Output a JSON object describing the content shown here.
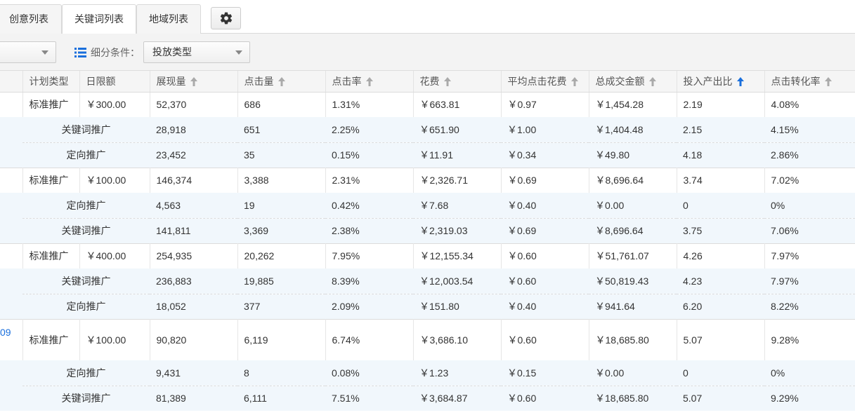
{
  "tabs": [
    {
      "label": "创意列表",
      "active": false
    },
    {
      "label": "关键词列表",
      "active": true
    },
    {
      "label": "地域列表",
      "active": false
    }
  ],
  "settings": {
    "icon": "gear-icon"
  },
  "filter": {
    "segment_label": "细分条件：",
    "segment_icon": "list-icon",
    "segment_value": "投放类型"
  },
  "table": {
    "columns": [
      {
        "label": "计划类型",
        "sortable": false
      },
      {
        "label": "日限额",
        "sortable": false
      },
      {
        "label": "展现量",
        "sortable": true
      },
      {
        "label": "点击量",
        "sortable": true
      },
      {
        "label": "点击率",
        "sortable": true
      },
      {
        "label": "花费",
        "sortable": true
      },
      {
        "label": "平均点击花费",
        "sortable": true
      },
      {
        "label": "总成交金额",
        "sortable": true
      },
      {
        "label": "投入产出比",
        "sortable": true,
        "active": true
      },
      {
        "label": "点击转化率",
        "sortable": true
      }
    ],
    "groups": [
      {
        "plan": {
          "type": "标准推广",
          "budget": "￥300.00",
          "impressions": "52,370",
          "clicks": "686",
          "ctr": "1.31%",
          "cost": "￥663.81",
          "cpc": "￥0.97",
          "gmv": "￥1,454.28",
          "roi": "2.19",
          "cvr": "4.08%"
        },
        "subs": [
          {
            "type": "关键词推广",
            "impressions": "28,918",
            "clicks": "651",
            "ctr": "2.25%",
            "cost": "￥651.90",
            "cpc": "￥1.00",
            "gmv": "￥1,404.48",
            "roi": "2.15",
            "cvr": "4.15%"
          },
          {
            "type": "定向推广",
            "impressions": "23,452",
            "clicks": "35",
            "ctr": "0.15%",
            "cost": "￥11.91",
            "cpc": "￥0.34",
            "gmv": "￥49.80",
            "roi": "4.18",
            "cvr": "2.86%"
          }
        ]
      },
      {
        "plan": {
          "type": "标准推广",
          "budget": "￥100.00",
          "impressions": "146,374",
          "clicks": "3,388",
          "ctr": "2.31%",
          "cost": "￥2,326.71",
          "cpc": "￥0.69",
          "gmv": "￥8,696.64",
          "roi": "3.74",
          "cvr": "7.02%"
        },
        "subs": [
          {
            "type": "定向推广",
            "impressions": "4,563",
            "clicks": "19",
            "ctr": "0.42%",
            "cost": "￥7.68",
            "cpc": "￥0.40",
            "gmv": "￥0.00",
            "roi": "0",
            "cvr": "0%"
          },
          {
            "type": "关键词推广",
            "impressions": "141,811",
            "clicks": "3,369",
            "ctr": "2.38%",
            "cost": "￥2,319.03",
            "cpc": "￥0.69",
            "gmv": "￥8,696.64",
            "roi": "3.75",
            "cvr": "7.06%"
          }
        ]
      },
      {
        "plan": {
          "type": "标准推广",
          "budget": "￥400.00",
          "impressions": "254,935",
          "clicks": "20,262",
          "ctr": "7.95%",
          "cost": "￥12,155.34",
          "cpc": "￥0.60",
          "gmv": "￥51,761.07",
          "roi": "4.26",
          "cvr": "7.97%"
        },
        "subs": [
          {
            "type": "关键词推广",
            "impressions": "236,883",
            "clicks": "19,885",
            "ctr": "8.39%",
            "cost": "￥12,003.54",
            "cpc": "￥0.60",
            "gmv": "￥50,819.43",
            "roi": "4.23",
            "cvr": "7.97%"
          },
          {
            "type": "定向推广",
            "impressions": "18,052",
            "clicks": "377",
            "ctr": "2.09%",
            "cost": "￥151.80",
            "cpc": "￥0.40",
            "gmv": "￥941.64",
            "roi": "6.20",
            "cvr": "8.22%"
          }
        ]
      },
      {
        "plan": {
          "name_fragment": "09",
          "type": "标准推广",
          "budget": "￥100.00",
          "impressions": "90,820",
          "clicks": "6,119",
          "ctr": "6.74%",
          "cost": "￥3,686.10",
          "cpc": "￥0.60",
          "gmv": "￥18,685.80",
          "roi": "5.07",
          "cvr": "9.28%"
        },
        "subs": [
          {
            "type": "定向推广",
            "impressions": "9,431",
            "clicks": "8",
            "ctr": "0.08%",
            "cost": "￥1.23",
            "cpc": "￥0.15",
            "gmv": "￥0.00",
            "roi": "0",
            "cvr": "0%"
          },
          {
            "type": "关键词推广",
            "impressions": "81,389",
            "clicks": "6,111",
            "ctr": "7.51%",
            "cost": "￥3,684.87",
            "cpc": "￥0.60",
            "gmv": "￥18,685.80",
            "roi": "5.07",
            "cvr": "9.29%"
          }
        ]
      }
    ]
  }
}
